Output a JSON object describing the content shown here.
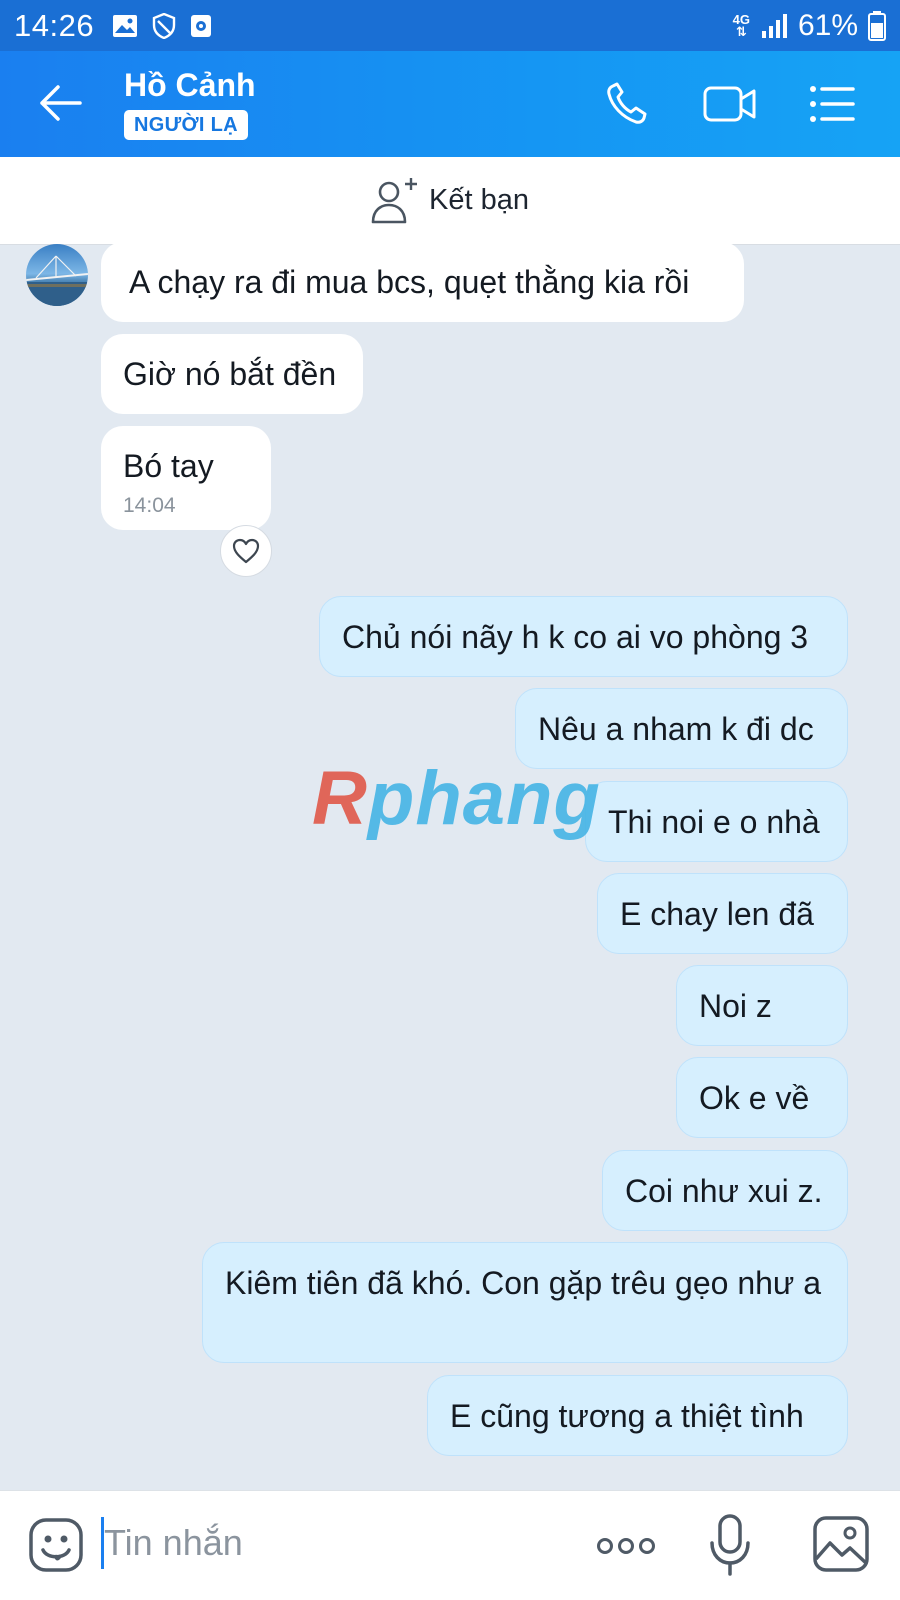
{
  "status_bar": {
    "time": "14:26",
    "network": "4G",
    "battery": "61%"
  },
  "header": {
    "contact_name": "Hồ Cảnh",
    "badge": "NGƯỜI LẠ",
    "accent": "#1a7ff0"
  },
  "friend_bar": {
    "label": "Kết bạn"
  },
  "messages": {
    "incoming": [
      "A chạy ra đi mua bcs, quẹt thằng kia rồi",
      "Giờ nó bắt đền",
      "Bó tay"
    ],
    "incoming_time": "14:04",
    "outgoing": [
      "Chủ nói nãy h k co ai vo phòng 3",
      "Nêu a nham k đi dc",
      "Thi noi e o nhà",
      "E chay len đã",
      "Noi z",
      "Ok e về",
      "Coi như xui z.",
      "Kiêm tiên đã khó. Con gặp trêu gẹo như a",
      "E cũng tương a thiệt tình"
    ]
  },
  "watermark": {
    "part1": "R",
    "part2": "phang"
  },
  "composer": {
    "placeholder": "Tin nhắn"
  }
}
